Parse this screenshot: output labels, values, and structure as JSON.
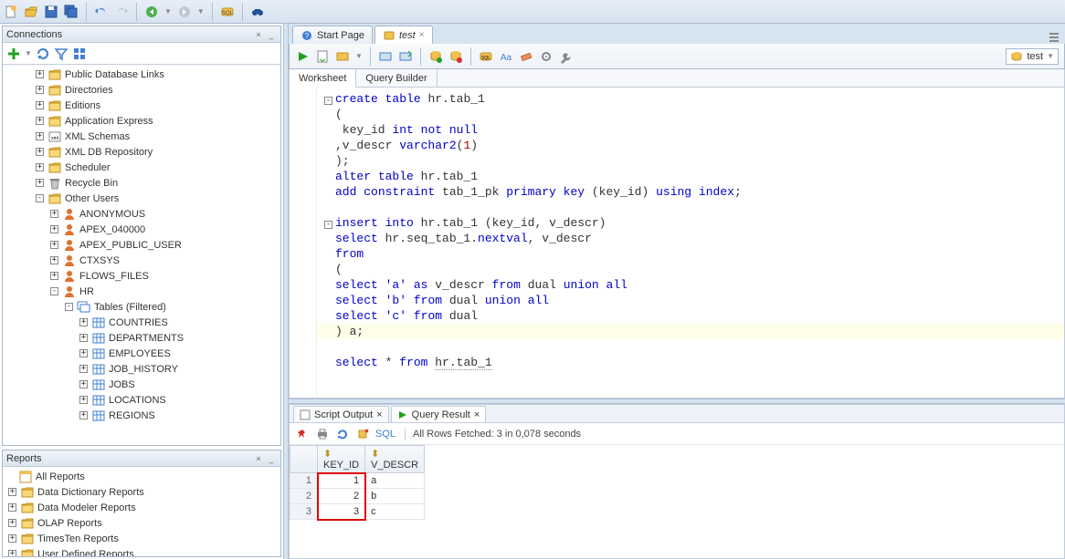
{
  "connections_panel": {
    "title": "Connections"
  },
  "reports_panel": {
    "title": "Reports"
  },
  "conn_tree": [
    {
      "indent": 1,
      "exp": "+",
      "icon": "folder",
      "label": "Public Database Links"
    },
    {
      "indent": 1,
      "exp": "+",
      "icon": "folder",
      "label": "Directories"
    },
    {
      "indent": 1,
      "exp": "+",
      "icon": "folder",
      "label": "Editions"
    },
    {
      "indent": 1,
      "exp": "+",
      "icon": "folder",
      "label": "Application Express"
    },
    {
      "indent": 1,
      "exp": "+",
      "icon": "xml",
      "label": "XML Schemas"
    },
    {
      "indent": 1,
      "exp": "+",
      "icon": "folder",
      "label": "XML DB Repository"
    },
    {
      "indent": 1,
      "exp": "+",
      "icon": "folder",
      "label": "Scheduler"
    },
    {
      "indent": 1,
      "exp": "+",
      "icon": "trash",
      "label": "Recycle Bin"
    },
    {
      "indent": 1,
      "exp": "-",
      "icon": "folder",
      "label": "Other Users"
    },
    {
      "indent": 2,
      "exp": "+",
      "icon": "user",
      "label": "ANONYMOUS"
    },
    {
      "indent": 2,
      "exp": "+",
      "icon": "user",
      "label": "APEX_040000"
    },
    {
      "indent": 2,
      "exp": "+",
      "icon": "user",
      "label": "APEX_PUBLIC_USER"
    },
    {
      "indent": 2,
      "exp": "+",
      "icon": "user",
      "label": "CTXSYS"
    },
    {
      "indent": 2,
      "exp": "+",
      "icon": "user",
      "label": "FLOWS_FILES"
    },
    {
      "indent": 2,
      "exp": "-",
      "icon": "user",
      "label": "HR"
    },
    {
      "indent": 3,
      "exp": "-",
      "icon": "tables",
      "label": "Tables (Filtered)"
    },
    {
      "indent": 4,
      "exp": "+",
      "icon": "table",
      "label": "COUNTRIES"
    },
    {
      "indent": 4,
      "exp": "+",
      "icon": "table",
      "label": "DEPARTMENTS"
    },
    {
      "indent": 4,
      "exp": "+",
      "icon": "table",
      "label": "EMPLOYEES"
    },
    {
      "indent": 4,
      "exp": "+",
      "icon": "table",
      "label": "JOB_HISTORY"
    },
    {
      "indent": 4,
      "exp": "+",
      "icon": "table",
      "label": "JOBS"
    },
    {
      "indent": 4,
      "exp": "+",
      "icon": "table",
      "label": "LOCATIONS"
    },
    {
      "indent": 4,
      "exp": "+",
      "icon": "table",
      "label": "REGIONS"
    }
  ],
  "reports_tree": [
    {
      "indent": 0,
      "exp": "",
      "icon": "reports",
      "label": "All Reports"
    },
    {
      "indent": 0,
      "exp": "+",
      "icon": "folder",
      "label": "Data Dictionary Reports"
    },
    {
      "indent": 0,
      "exp": "+",
      "icon": "folder",
      "label": "Data Modeler Reports"
    },
    {
      "indent": 0,
      "exp": "+",
      "icon": "folder",
      "label": "OLAP Reports"
    },
    {
      "indent": 0,
      "exp": "+",
      "icon": "folder",
      "label": "TimesTen Reports"
    },
    {
      "indent": 0,
      "exp": "+",
      "icon": "folder",
      "label": "User Defined Reports"
    }
  ],
  "editor": {
    "tabs": [
      {
        "label": "Start Page",
        "icon": "start",
        "active": false
      },
      {
        "label": "test",
        "icon": "sql",
        "active": true,
        "italic": true
      }
    ],
    "schema_dropdown": "test",
    "sub_tabs": [
      {
        "label": "Worksheet",
        "active": true
      },
      {
        "label": "Query Builder",
        "active": false
      }
    ]
  },
  "code_lines": [
    {
      "fold": "-",
      "html": "<span class='kw'>create</span> <span class='kw'>table</span> hr.tab_1"
    },
    {
      "fold": "",
      "html": "("
    },
    {
      "fold": "",
      "html": " key_id <span class='kw'>int</span> <span class='kw'>not</span> <span class='kw'>null</span>"
    },
    {
      "fold": "",
      "html": ",v_descr <span class='kw'>varchar2</span>(<span class='lit'>1</span>)"
    },
    {
      "fold": "",
      "html": ");"
    },
    {
      "fold": "",
      "html": "<span class='kw'>alter</span> <span class='kw'>table</span> hr.tab_1"
    },
    {
      "fold": "",
      "html": "<span class='kw'>add</span> <span class='kw'>constraint</span> tab_1_pk <span class='kw'>primary</span> <span class='kw'>key</span> (key_id) <span class='kw'>using</span> <span class='kw'>index</span>;"
    },
    {
      "fold": "",
      "html": ""
    },
    {
      "fold": "-",
      "html": "<span class='kw'>insert</span> <span class='kw'>into</span> hr.tab_1 (key_id, v_descr)"
    },
    {
      "fold": "",
      "html": "<span class='kw'>select</span> hr.seq_tab_1.<span class='kw'>nextval</span>, v_descr"
    },
    {
      "fold": "",
      "html": "<span class='kw'>from</span>"
    },
    {
      "fold": "",
      "html": "("
    },
    {
      "fold": "",
      "html": "<span class='kw'>select</span> <span class='kw'>'a'</span> <span class='kw'>as</span> v_descr <span class='kw'>from</span> dual <span class='kw'>union</span> <span class='kw'>all</span>"
    },
    {
      "fold": "",
      "html": "<span class='kw'>select</span> <span class='kw'>'b'</span> <span class='kw'>from</span> dual <span class='kw'>union</span> <span class='kw'>all</span>"
    },
    {
      "fold": "",
      "html": "<span class='kw'>select</span> <span class='kw'>'c'</span> <span class='kw'>from</span> dual"
    },
    {
      "fold": "",
      "html": ") a;",
      "hl": true
    },
    {
      "fold": "",
      "html": ""
    },
    {
      "fold": "",
      "html": "<span class='kw'>select</span> * <span class='kw'>from</span> hr.tab_1",
      "underline_end": true
    }
  ],
  "results": {
    "tabs": [
      {
        "label": "Script Output",
        "active": false
      },
      {
        "label": "Query Result",
        "active": true,
        "play": true
      }
    ],
    "sql_label": "SQL",
    "status": "All Rows Fetched: 3 in 0,078 seconds",
    "columns": [
      "KEY_ID",
      "V_DESCR"
    ],
    "rows": [
      {
        "n": 1,
        "key_id": 1,
        "v_descr": "a"
      },
      {
        "n": 2,
        "key_id": 2,
        "v_descr": "b"
      },
      {
        "n": 3,
        "key_id": 3,
        "v_descr": "c"
      }
    ]
  }
}
